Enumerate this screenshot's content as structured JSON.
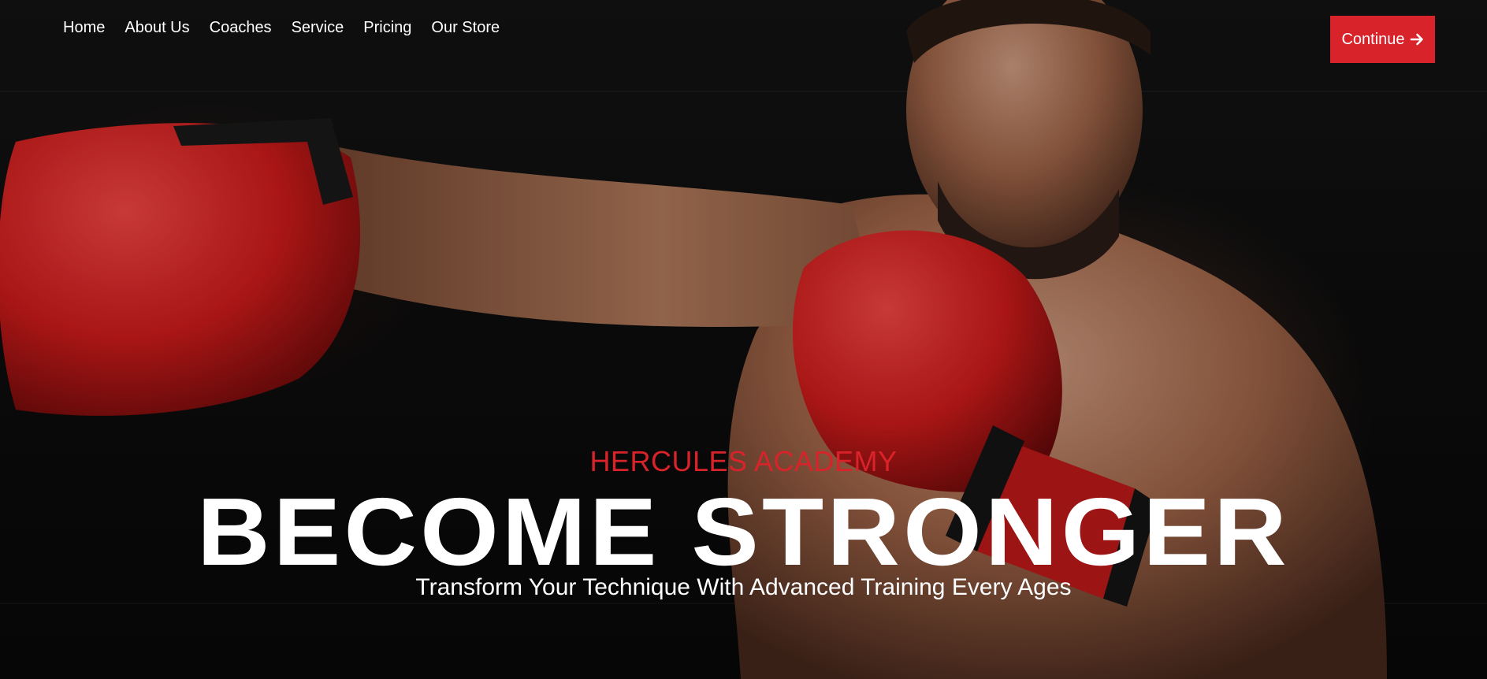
{
  "nav": {
    "items": [
      {
        "label": "Home"
      },
      {
        "label": "About Us"
      },
      {
        "label": "Coaches"
      },
      {
        "label": "Service"
      },
      {
        "label": "Pricing"
      },
      {
        "label": "Our Store"
      }
    ]
  },
  "cta": {
    "label": "Continue",
    "icon": "arrow-right-icon"
  },
  "hero": {
    "eyebrow": "HERCULES ACADEMY",
    "headline": "BECOME STRONGER",
    "subline": "Transform Your Technique With Advanced Training Every Ages",
    "image": "boxer-with-red-gloves-photo"
  },
  "colors": {
    "accent": "#d9232a",
    "text": "#ffffff",
    "background": "#0b0b0b"
  }
}
